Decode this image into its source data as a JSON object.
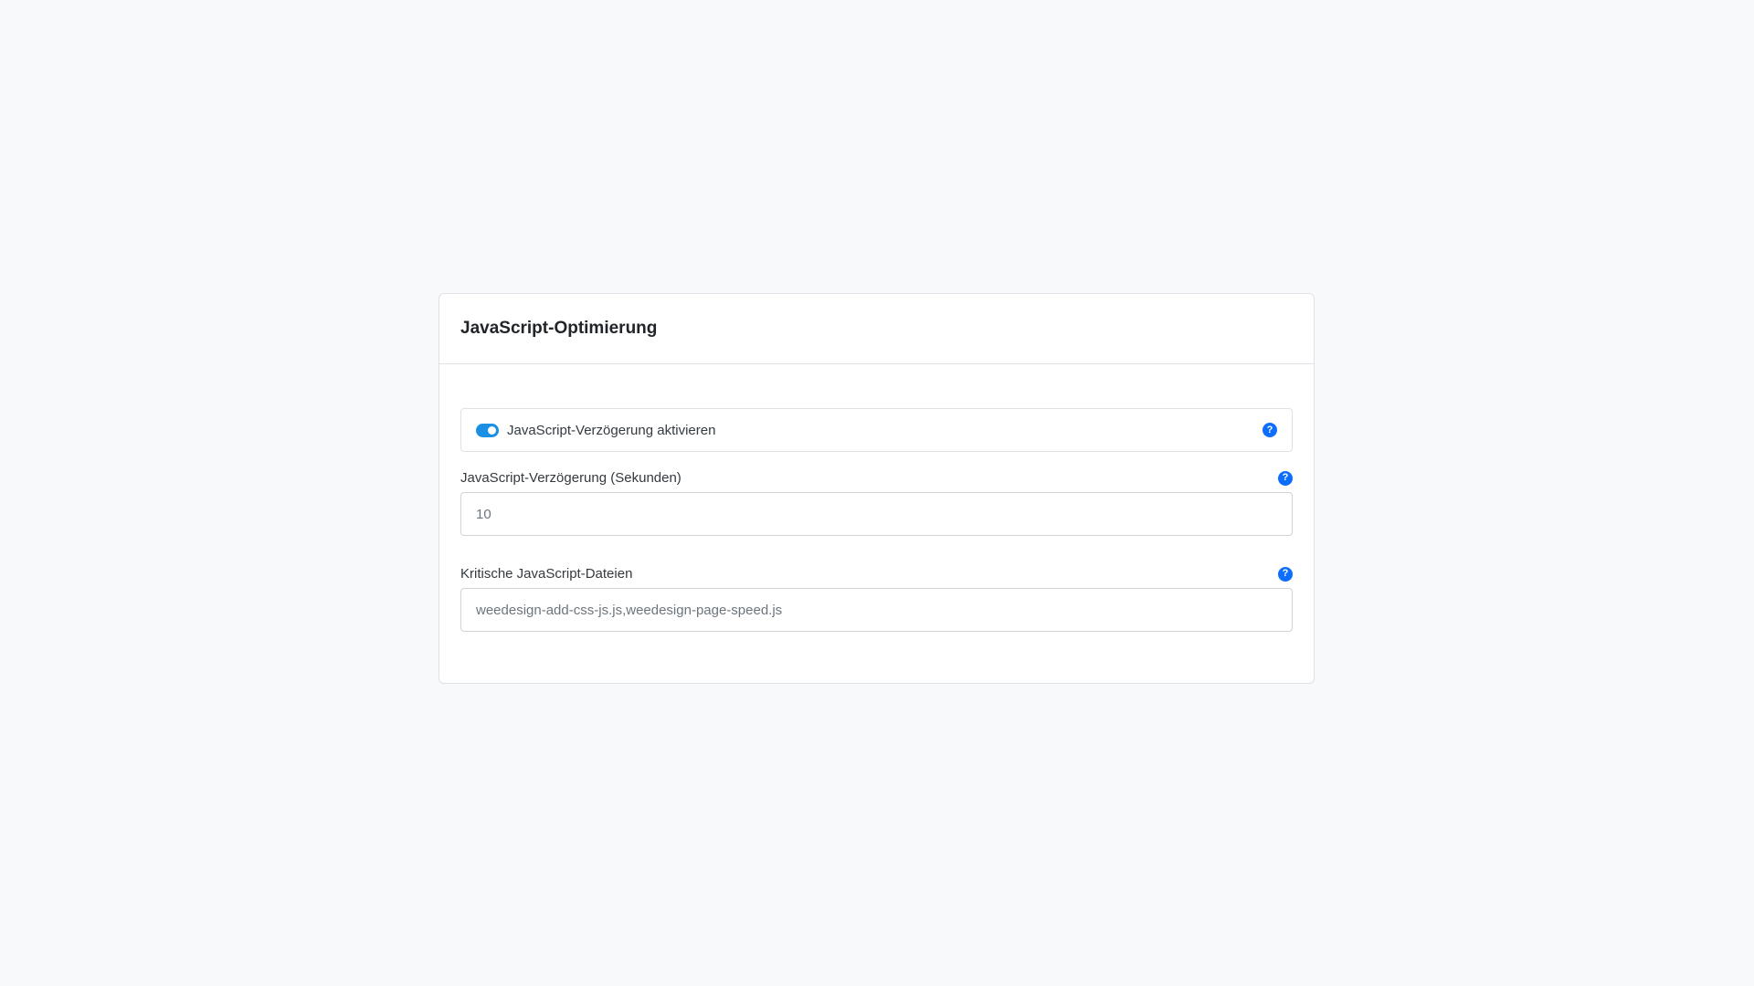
{
  "card": {
    "title": "JavaScript-Optimierung"
  },
  "delay_toggle": {
    "label": "JavaScript-Verzögerung aktivieren",
    "checked": true,
    "accent_color": "#1a8fe3"
  },
  "delay_seconds": {
    "label": "JavaScript-Verzögerung (Sekunden)",
    "value": "10"
  },
  "critical_files": {
    "label": "Kritische JavaScript-Dateien",
    "value": "weedesign-add-css-js.js,weedesign-page-speed.js"
  },
  "help": {
    "icon": "question-circle-icon",
    "glyph": "?",
    "color": "#0d6efd"
  }
}
